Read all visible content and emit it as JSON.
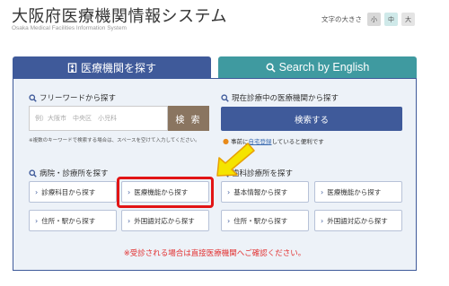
{
  "header": {
    "title": "大阪府医療機関情報システム",
    "subtitle": "Osaka Medical Facilities Information System"
  },
  "font_size": {
    "label": "文字の大きさ",
    "small": "小",
    "medium": "中",
    "large": "大"
  },
  "tabs": {
    "japanese": "医療機関を探す",
    "english": "Search by English"
  },
  "freeword": {
    "title": "フリーワードから探す",
    "placeholder": "例）大阪市　中央区　小児科",
    "button": "検 索",
    "note": "※複数のキーワードで検索する場合は、スペースを空けて入力してください。"
  },
  "current_location": {
    "title": "現在診療中の医療機関から探す",
    "button": "検索する",
    "note_prefix": "事前に",
    "note_link": "自宅登録",
    "note_suffix": "していると便利です"
  },
  "hospital_section": {
    "title": "病院・診療所を探す",
    "buttons": [
      "診療科目から探す",
      "医療機能から探す",
      "住所・駅から探す",
      "外国語対応から探す"
    ]
  },
  "dental_section": {
    "title": "歯科診療所を探す",
    "buttons": [
      "基本情報から探す",
      "医療機能から探す",
      "住所・駅から探す",
      "外国語対応から探す"
    ]
  },
  "warning": "※受診される場合は直接医療機関へご確認ください。",
  "colors": {
    "primary_blue": "#3f5a9a",
    "teal": "#3f9aa0",
    "search_button": "#8a7560",
    "highlight_red": "#e21515",
    "arrow_yellow": "#f5e400"
  }
}
